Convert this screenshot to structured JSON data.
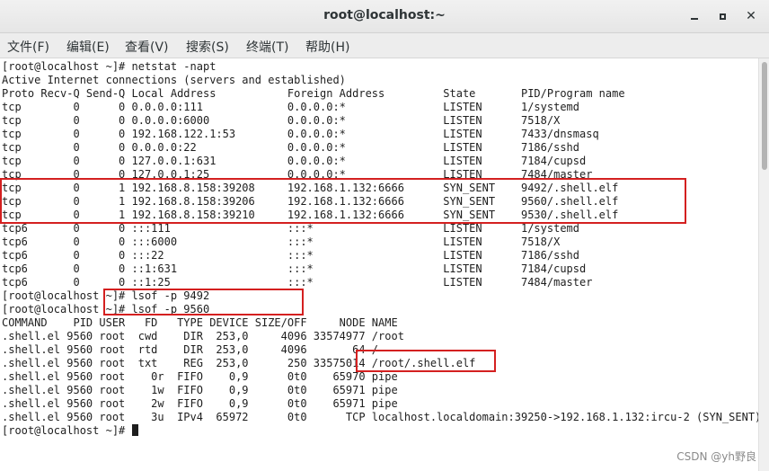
{
  "window": {
    "title": "root@localhost:~",
    "minimize_glyph": "",
    "maximize_glyph": "",
    "close_glyph": "✕"
  },
  "menu": [
    "文件(F)",
    "编辑(E)",
    "查看(V)",
    "搜索(S)",
    "终端(T)",
    "帮助(H)"
  ],
  "terminal": {
    "lines": [
      "[root@localhost ~]# netstat -napt",
      "Active Internet connections (servers and established)",
      "Proto Recv-Q Send-Q Local Address           Foreign Address         State       PID/Program name",
      "tcp        0      0 0.0.0.0:111             0.0.0.0:*               LISTEN      1/systemd",
      "tcp        0      0 0.0.0.0:6000            0.0.0.0:*               LISTEN      7518/X",
      "tcp        0      0 192.168.122.1:53        0.0.0.0:*               LISTEN      7433/dnsmasq",
      "tcp        0      0 0.0.0.0:22              0.0.0.0:*               LISTEN      7186/sshd",
      "tcp        0      0 127.0.0.1:631           0.0.0.0:*               LISTEN      7184/cupsd",
      "tcp        0      0 127.0.0.1:25            0.0.0.0:*               LISTEN      7484/master",
      "tcp        0      1 192.168.8.158:39208     192.168.1.132:6666      SYN_SENT    9492/.shell.elf",
      "tcp        0      1 192.168.8.158:39206     192.168.1.132:6666      SYN_SENT    9560/.shell.elf",
      "tcp        0      1 192.168.8.158:39210     192.168.1.132:6666      SYN_SENT    9530/.shell.elf",
      "tcp6       0      0 :::111                  :::*                    LISTEN      1/systemd",
      "tcp6       0      0 :::6000                 :::*                    LISTEN      7518/X",
      "tcp6       0      0 :::22                   :::*                    LISTEN      7186/sshd",
      "tcp6       0      0 ::1:631                 :::*                    LISTEN      7184/cupsd",
      "tcp6       0      0 ::1:25                  :::*                    LISTEN      7484/master",
      "[root@localhost ~]# lsof -p 9492",
      "[root@localhost ~]# lsof -p 9560",
      "COMMAND    PID USER   FD   TYPE DEVICE SIZE/OFF     NODE NAME",
      ".shell.el 9560 root  cwd    DIR  253,0     4096 33574977 /root",
      ".shell.el 9560 root  rtd    DIR  253,0     4096       64 /",
      ".shell.el 9560 root  txt    REG  253,0      250 33575014 /root/.shell.elf",
      ".shell.el 9560 root    0r  FIFO    0,9      0t0    65970 pipe",
      ".shell.el 9560 root    1w  FIFO    0,9      0t0    65971 pipe",
      ".shell.el 9560 root    2w  FIFO    0,9      0t0    65971 pipe",
      ".shell.el 9560 root    3u  IPv4  65972      0t0      TCP localhost.localdomain:39250->192.168.1.132:ircu-2 (SYN_SENT)"
    ],
    "prompt": "[root@localhost ~]# "
  },
  "watermark": "CSDN @yh野良",
  "colors": {
    "annotation": "#d42020",
    "text": "#1e1e1e"
  }
}
